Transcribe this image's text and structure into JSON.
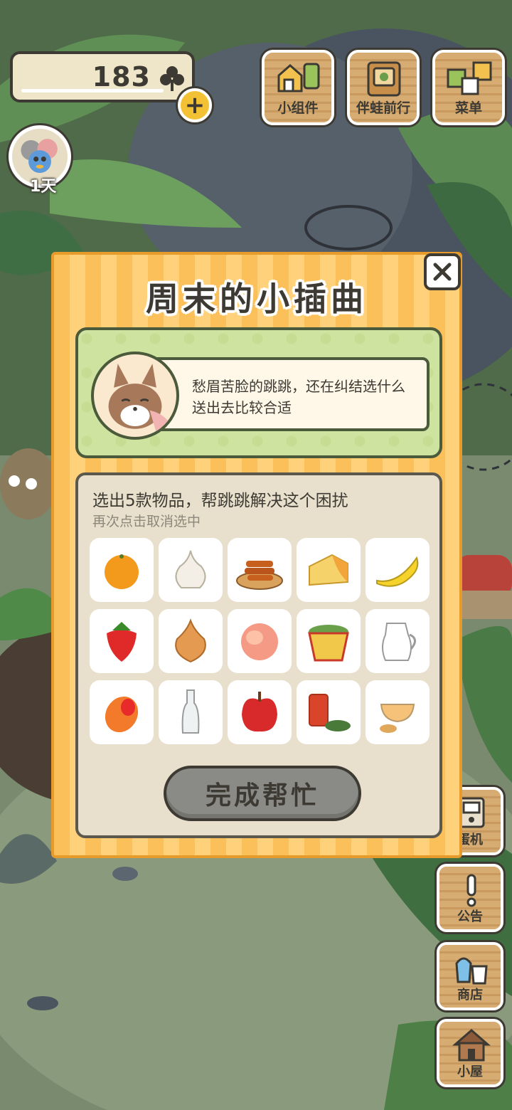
{
  "hud": {
    "clover_count": "183",
    "clover_icon": "clover-icon",
    "plus_icon": "plus-icon",
    "plus_label": "+",
    "days_label": "1天"
  },
  "top_buttons": [
    {
      "label": "小组件",
      "icon": "widget-icon"
    },
    {
      "label": "伴蛙前行",
      "icon": "journey-book-icon"
    },
    {
      "label": "菜单",
      "icon": "menu-cards-icon"
    }
  ],
  "side_buttons": [
    {
      "label": "蛋机",
      "icon": "gacha-machine-icon"
    },
    {
      "label": "公告",
      "icon": "exclamation-icon"
    },
    {
      "label": "商店",
      "icon": "shop-bags-icon"
    },
    {
      "label": "小屋",
      "icon": "house-icon"
    }
  ],
  "dialog": {
    "title": "周末的小插曲",
    "story_text": "愁眉苦脸的跳跳，还在纠结选什么送出去比较合适",
    "select_title": "选出5款物品，帮跳跳解决这个困扰",
    "select_hint": "再次点击取消选中",
    "done_label": "完成帮忙",
    "close_icon": "close-icon",
    "items": [
      {
        "name": "orange"
      },
      {
        "name": "garlic"
      },
      {
        "name": "fried-dough-twists"
      },
      {
        "name": "cheese"
      },
      {
        "name": "banana"
      },
      {
        "name": "strawberry"
      },
      {
        "name": "onion"
      },
      {
        "name": "peach"
      },
      {
        "name": "cup-noodles"
      },
      {
        "name": "milk-jug"
      },
      {
        "name": "mango"
      },
      {
        "name": "glass-bottle"
      },
      {
        "name": "apple"
      },
      {
        "name": "tea-can-and-leaves"
      },
      {
        "name": "ginger-tea"
      }
    ]
  },
  "colors": {
    "dialog_stripe_a": "#fbc05a",
    "dialog_stripe_b": "#ffd17a",
    "story_green": "#cfe3a0",
    "panel_beige": "#e8e0cc",
    "button_gray": "#8a8a86",
    "ink": "#3d3a33"
  }
}
